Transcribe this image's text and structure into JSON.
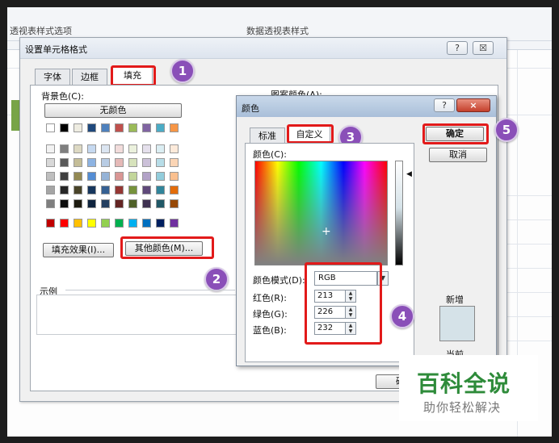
{
  "ribbon": {
    "left_label": "透视表样式选项",
    "center_label": "数据透视表样式"
  },
  "format_dialog": {
    "title": "设置单元格格式",
    "help_btn": "?",
    "close_btn": "☒",
    "tabs": [
      "字体",
      "边框",
      "填充"
    ],
    "background_color_label": "背景色(C):",
    "no_color_button": "无颜色",
    "fill_effects_button": "填充效果(I)...",
    "more_colors_button": "其他颜色(M)...",
    "pattern_color_label": "图案颜色(A):",
    "sample_label": "示例",
    "ok_partial": "确"
  },
  "color_dialog": {
    "title": "颜色",
    "help_btn": "?",
    "close_btn": "×",
    "tabs": [
      "标准",
      "自定义"
    ],
    "colors_label": "颜色(C):",
    "color_model_label": "颜色模式(D):",
    "color_model_value": "RGB",
    "red_label": "红色(R):",
    "red_value": "213",
    "green_label": "绿色(G):",
    "green_value": "226",
    "blue_label": "蓝色(B):",
    "blue_value": "232",
    "ok_button": "确定",
    "cancel_button": "取消",
    "new_label": "新增",
    "current_label": "当前",
    "new_color": "#d5e2e8"
  },
  "badges": [
    "1",
    "2",
    "3",
    "4",
    "5"
  ],
  "watermark": {
    "main": "百科全说",
    "sub": "助你轻松解决"
  },
  "palette": {
    "row0": [
      "#ffffff",
      "#000000",
      "#eeece1",
      "#1f497d",
      "#4f81bd",
      "#c0504d",
      "#9bbb59",
      "#8064a2",
      "#4bacc6",
      "#f79646"
    ],
    "grid": [
      [
        "#f2f2f2",
        "#7f7f7f",
        "#ddd9c3",
        "#c6d9f0",
        "#dbe5f1",
        "#f2dcdb",
        "#ebf1dd",
        "#e5e0ec",
        "#dbeef3",
        "#fdeada"
      ],
      [
        "#d8d8d8",
        "#595959",
        "#c4bd97",
        "#8db3e2",
        "#b8cce4",
        "#e5b9b7",
        "#d7e3bc",
        "#ccc1d9",
        "#b7dde8",
        "#fbd5b5"
      ],
      [
        "#bfbfbf",
        "#3f3f3f",
        "#938953",
        "#548dd4",
        "#95b3d7",
        "#d99694",
        "#c3d69b",
        "#b2a2c7",
        "#92cddc",
        "#fac08f"
      ],
      [
        "#a5a5a5",
        "#262626",
        "#494429",
        "#17365d",
        "#366092",
        "#953734",
        "#76923c",
        "#5f497a",
        "#31859b",
        "#e36c09"
      ],
      [
        "#7f7f7f",
        "#0c0c0c",
        "#1d1b10",
        "#0f243e",
        "#244061",
        "#632423",
        "#4f6128",
        "#3f3151",
        "#205867",
        "#974806"
      ]
    ],
    "standard": [
      "#c00000",
      "#ff0000",
      "#ffc000",
      "#ffff00",
      "#92d050",
      "#00b050",
      "#00b0f0",
      "#0070c0",
      "#002060",
      "#7030a0"
    ]
  }
}
